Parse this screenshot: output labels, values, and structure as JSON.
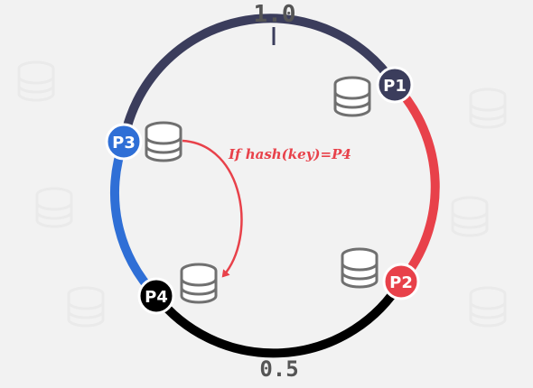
{
  "ring": {
    "top_label": "1.0",
    "bottom_label": "0.5"
  },
  "partitions": [
    {
      "id": "p1",
      "label": "P1",
      "color": "#3b3d5c"
    },
    {
      "id": "p2",
      "label": "P2",
      "color": "#e8414a"
    },
    {
      "id": "p3",
      "label": "P3",
      "color": "#2f6fd6"
    },
    {
      "id": "p4",
      "label": "P4",
      "color": "#000000"
    }
  ],
  "arcs": [
    {
      "from": "P3",
      "to": "P1",
      "color": "#3b3d5c"
    },
    {
      "from": "P1",
      "to": "P2",
      "color": "#e8414a"
    },
    {
      "from": "P2",
      "to": "P4",
      "color": "#000000"
    },
    {
      "from": "P4",
      "to": "P3",
      "color": "#2f6fd6"
    }
  ],
  "annotation": {
    "text": "If hash(key)=P4",
    "color": "#e8414a"
  },
  "icons": {
    "database": "database-icon",
    "arrow": "curved-arrow"
  }
}
